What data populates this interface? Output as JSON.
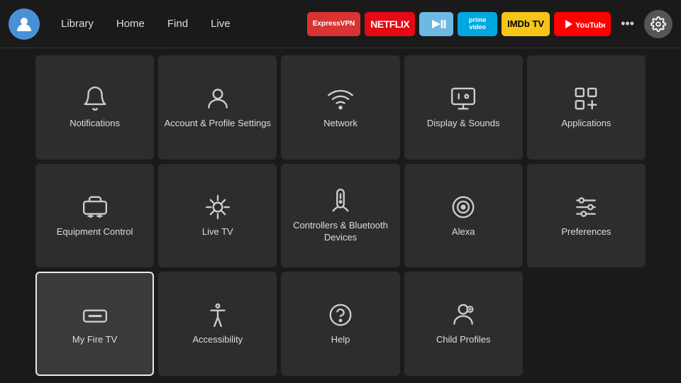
{
  "topbar": {
    "nav": [
      {
        "label": "Library",
        "name": "library"
      },
      {
        "label": "Home",
        "name": "home"
      },
      {
        "label": "Find",
        "name": "find"
      },
      {
        "label": "Live",
        "name": "live"
      }
    ],
    "apps": [
      {
        "label": "ExpressVPN",
        "name": "expressvpn",
        "class": "badge-expressvpn"
      },
      {
        "label": "NETFLIX",
        "name": "netflix",
        "class": "badge-netflix"
      },
      {
        "label": "▶",
        "name": "freevee",
        "class": "badge-freeveee"
      },
      {
        "label": "prime video",
        "name": "prime",
        "class": "badge-prime"
      },
      {
        "label": "IMDb TV",
        "name": "imdb",
        "class": "badge-imdb"
      },
      {
        "label": "▶ YouTube",
        "name": "youtube",
        "class": "badge-youtube"
      }
    ],
    "more_label": "•••",
    "settings_label": "⚙"
  },
  "grid": [
    {
      "id": "notifications",
      "label": "Notifications",
      "icon": "bell",
      "selected": false
    },
    {
      "id": "account",
      "label": "Account & Profile Settings",
      "icon": "person",
      "selected": false
    },
    {
      "id": "network",
      "label": "Network",
      "icon": "wifi",
      "selected": false
    },
    {
      "id": "display",
      "label": "Display & Sounds",
      "icon": "display",
      "selected": false
    },
    {
      "id": "applications",
      "label": "Applications",
      "icon": "apps",
      "selected": false
    },
    {
      "id": "equipment",
      "label": "Equipment Control",
      "icon": "tv-monitor",
      "selected": false
    },
    {
      "id": "livetv",
      "label": "Live TV",
      "icon": "antenna",
      "selected": false
    },
    {
      "id": "controllers",
      "label": "Controllers & Bluetooth Devices",
      "icon": "remote",
      "selected": false
    },
    {
      "id": "alexa",
      "label": "Alexa",
      "icon": "alexa",
      "selected": false
    },
    {
      "id": "preferences",
      "label": "Preferences",
      "icon": "sliders",
      "selected": false
    },
    {
      "id": "myfiretv",
      "label": "My Fire TV",
      "icon": "firetv",
      "selected": true
    },
    {
      "id": "accessibility",
      "label": "Accessibility",
      "icon": "accessibility",
      "selected": false
    },
    {
      "id": "help",
      "label": "Help",
      "icon": "help",
      "selected": false
    },
    {
      "id": "childprofiles",
      "label": "Child Profiles",
      "icon": "child",
      "selected": false
    }
  ]
}
